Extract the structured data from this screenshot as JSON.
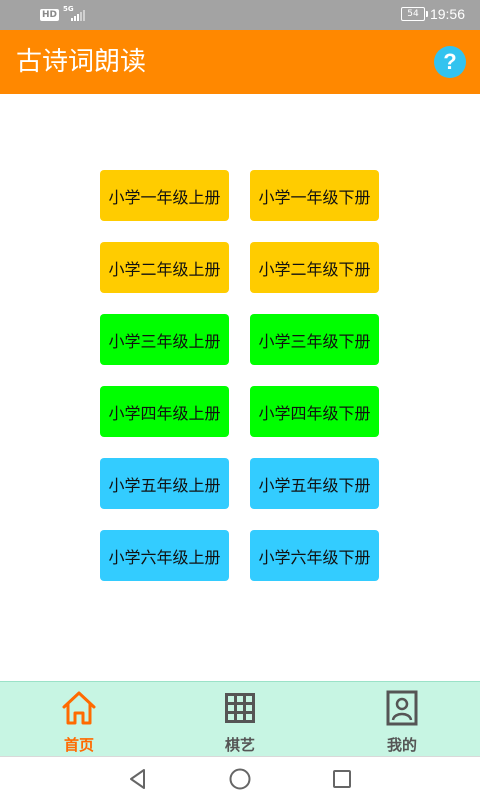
{
  "status_bar": {
    "hd": "HD",
    "network": "5G",
    "battery": "54",
    "time": "19:56"
  },
  "app_bar": {
    "title": "古诗词朗读",
    "help_icon": "question-icon",
    "help_label": "?"
  },
  "grades": [
    {
      "label": "小学一年级上册",
      "color": "#ffcc00"
    },
    {
      "label": "小学一年级下册",
      "color": "#ffcc00"
    },
    {
      "label": "小学二年级上册",
      "color": "#ffcc00"
    },
    {
      "label": "小学二年级下册",
      "color": "#ffcc00"
    },
    {
      "label": "小学三年级上册",
      "color": "#00ff00"
    },
    {
      "label": "小学三年级下册",
      "color": "#00ff00"
    },
    {
      "label": "小学四年级上册",
      "color": "#00ff00"
    },
    {
      "label": "小学四年级下册",
      "color": "#00ff00"
    },
    {
      "label": "小学五年级上册",
      "color": "#33ccff"
    },
    {
      "label": "小学五年级下册",
      "color": "#33ccff"
    },
    {
      "label": "小学六年级上册",
      "color": "#33ccff"
    },
    {
      "label": "小学六年级下册",
      "color": "#33ccff"
    }
  ],
  "bottom_nav": {
    "items": [
      {
        "label": "首页",
        "icon": "home-icon",
        "active": true
      },
      {
        "label": "棋艺",
        "icon": "grid-icon",
        "active": false
      },
      {
        "label": "我的",
        "icon": "profile-icon",
        "active": false
      }
    ]
  },
  "colors": {
    "accent": "#ff8800",
    "active_nav": "#ff6a00",
    "nav_background": "#c7f5e3",
    "help_button": "#33c3ef"
  }
}
